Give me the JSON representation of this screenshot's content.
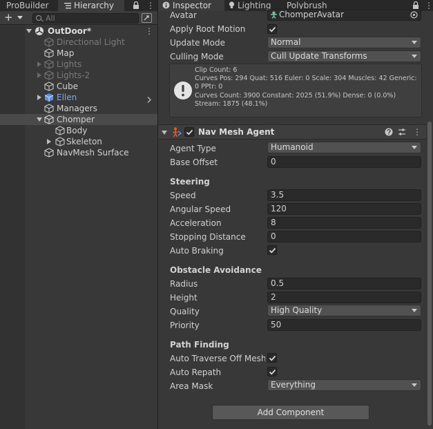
{
  "left_tabs": {
    "probuilder": "ProBuilder",
    "hierarchy": "Hierarchy"
  },
  "hierarchy": {
    "search_placeholder": "All",
    "nodes": [
      {
        "label": "OutDoor*"
      },
      {
        "label": "Directional Light"
      },
      {
        "label": "Map"
      },
      {
        "label": "Lights"
      },
      {
        "label": "Lights-2"
      },
      {
        "label": "Cube"
      },
      {
        "label": "Ellen"
      },
      {
        "label": "Managers"
      },
      {
        "label": "Chomper"
      },
      {
        "label": "Body"
      },
      {
        "label": "Skeleton"
      },
      {
        "label": "NavMesh Surface"
      }
    ]
  },
  "right_tabs": {
    "inspector": "Inspector",
    "lighting": "Lighting",
    "polybrush": "Polybrush"
  },
  "animator": {
    "avatar_label": "Avatar",
    "avatar_value": "ChomperAvatar",
    "apply_root_motion_label": "Apply Root Motion",
    "update_mode_label": "Update Mode",
    "update_mode_value": "Normal",
    "culling_mode_label": "Culling Mode",
    "culling_mode_value": "Cull Update Transforms",
    "info_lines": [
      "Clip Count: 6",
      "Curves Pos: 294 Quat: 516 Euler: 0 Scale: 304 Muscles: 42 Generic:",
      "0 PPtr: 0",
      "Curves Count: 3900 Constant: 2025 (51.9%) Dense: 0 (0.0%)",
      "Stream: 1875 (48.1%)"
    ]
  },
  "nav_mesh_agent": {
    "title": "Nav Mesh Agent",
    "agent_type_label": "Agent Type",
    "agent_type_value": "Humanoid",
    "base_offset_label": "Base Offset",
    "base_offset_value": "0",
    "steering_header": "Steering",
    "speed_label": "Speed",
    "speed_value": "3.5",
    "angular_speed_label": "Angular Speed",
    "angular_speed_value": "120",
    "acceleration_label": "Acceleration",
    "acceleration_value": "8",
    "stopping_distance_label": "Stopping Distance",
    "stopping_distance_value": "0",
    "auto_braking_label": "Auto Braking",
    "obstacle_header": "Obstacle Avoidance",
    "radius_label": "Radius",
    "radius_value": "0.5",
    "height_label": "Height",
    "height_value": "2",
    "quality_label": "Quality",
    "quality_value": "High Quality",
    "priority_label": "Priority",
    "priority_value": "50",
    "path_header": "Path Finding",
    "auto_traverse_label": "Auto Traverse Off Mesh L",
    "auto_repath_label": "Auto Repath",
    "area_mask_label": "Area Mask",
    "area_mask_value": "Everything"
  },
  "add_component_label": "Add Component",
  "colors": {
    "panel_bg": "#383838",
    "tab_bg": "#282828",
    "field_bg": "#2a2a2a",
    "prefab_blue": "#7ba8ef",
    "agent_icon": "#e05a2a"
  }
}
